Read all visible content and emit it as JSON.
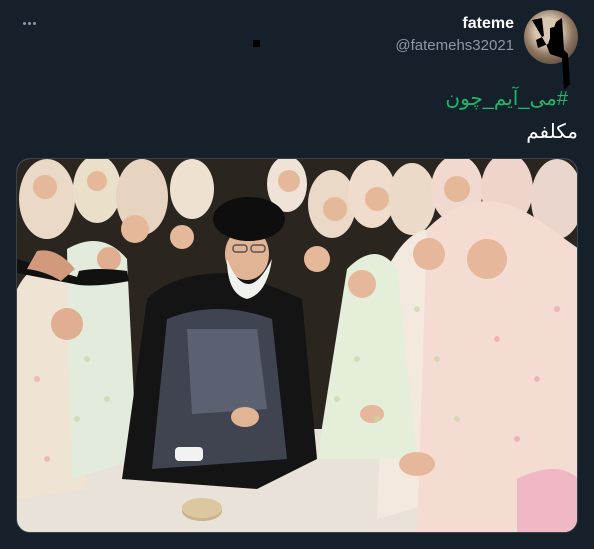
{
  "tweet": {
    "display_name": "fateme",
    "handle": "@fatemehs32021",
    "hashtag": "#می_آیم_چون",
    "text": "مکلفم"
  },
  "icons": {
    "more": "more-horizontal-icon"
  },
  "colors": {
    "background": "#15202b",
    "hashtag": "#21b56a",
    "text": "#ffffff",
    "muted": "#8b98a5"
  }
}
